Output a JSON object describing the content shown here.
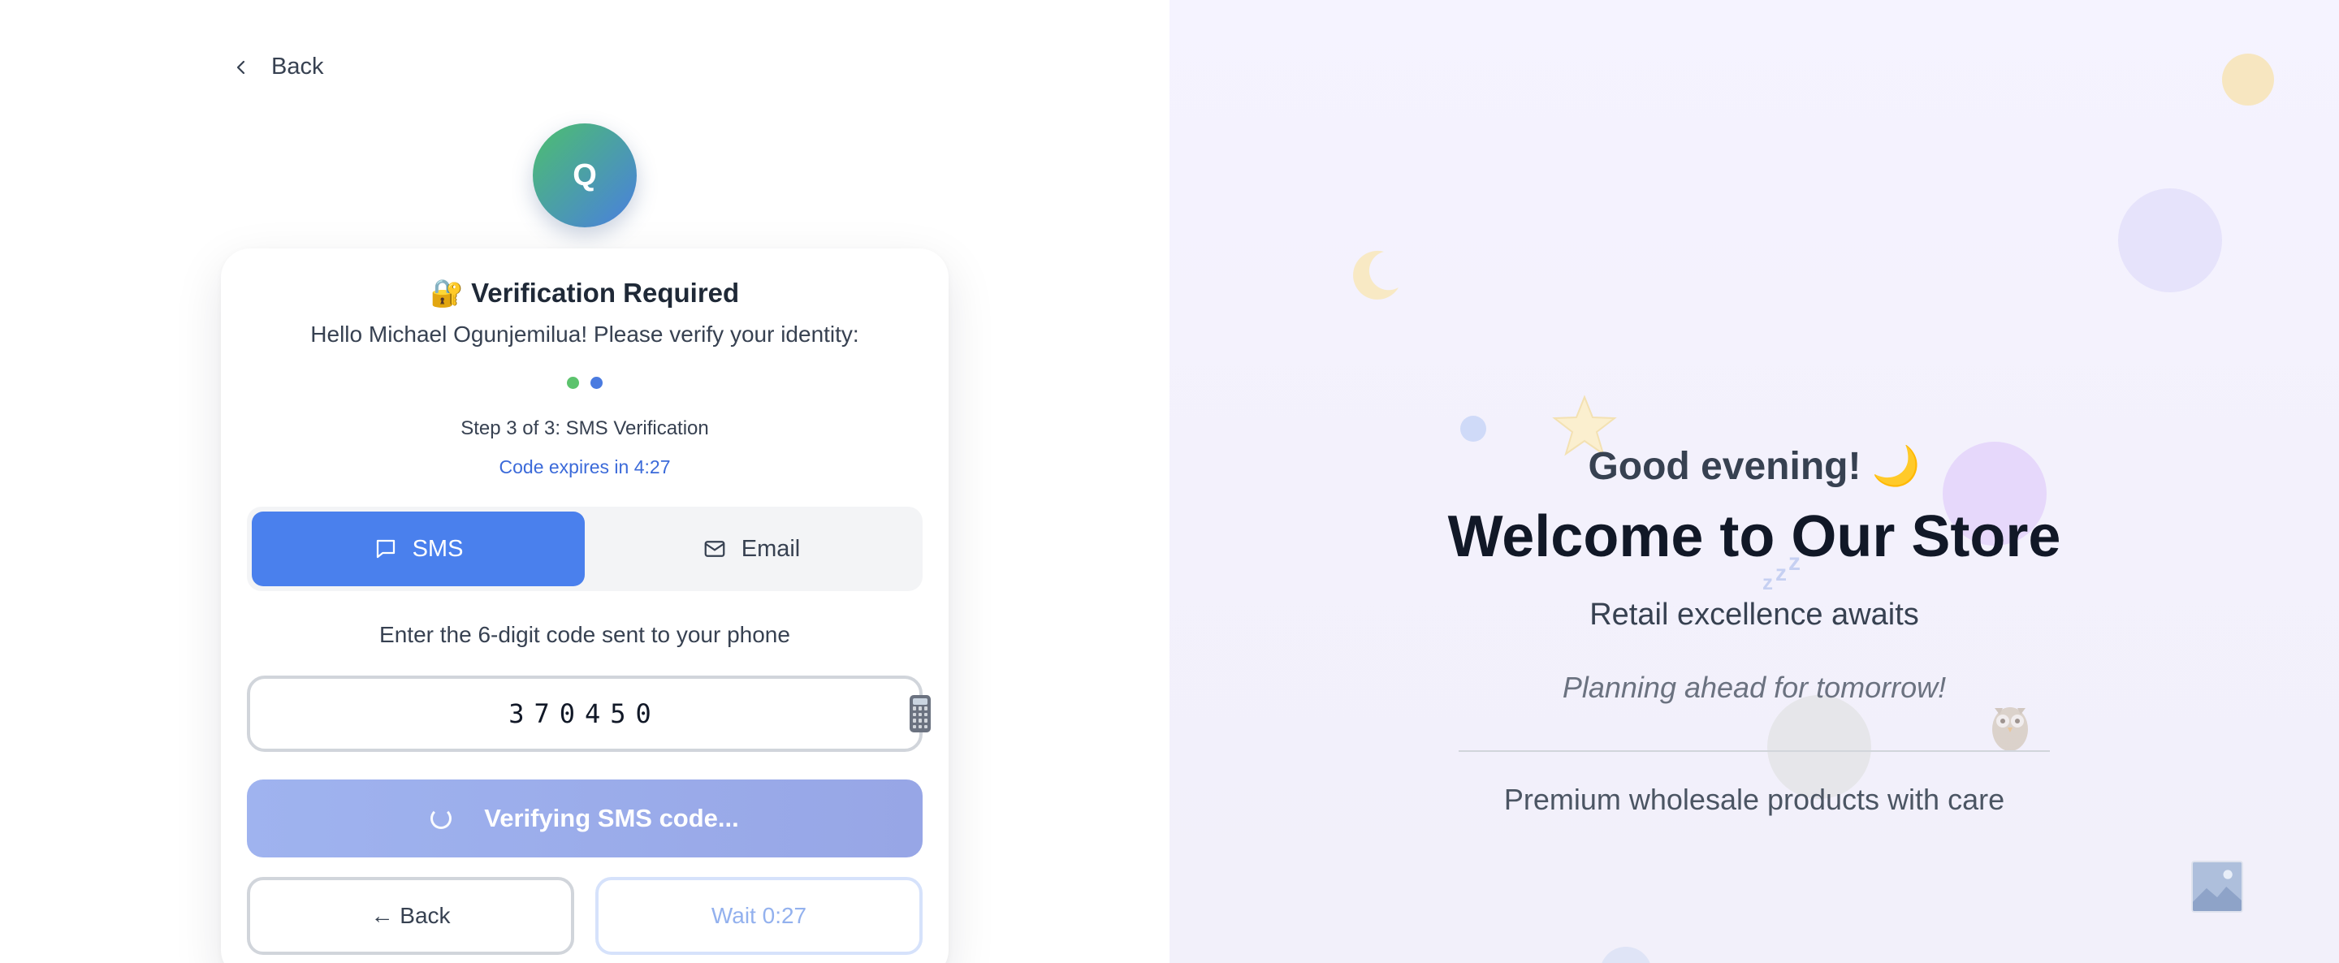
{
  "verification": {
    "back_label": "Back",
    "avatar_initial": "Q",
    "title": "🔐 Verification Required",
    "greeting": "Hello Michael Ogunjemilua! Please verify your identity:",
    "progress_dots": [
      {
        "state": "complete",
        "color": "#5cc36d"
      },
      {
        "state": "current",
        "color": "#4a7be0"
      }
    ],
    "step_text": "Step 3 of 3: SMS Verification",
    "expires_text": "Code expires in 4:27",
    "methods": [
      {
        "label": "SMS",
        "icon": "message-icon",
        "active": true
      },
      {
        "label": "Email",
        "icon": "mail-icon",
        "active": false
      }
    ],
    "instruction": "Enter the 6-digit code sent to your phone",
    "code_value": "370450",
    "code_suffix_icon": "phone-icon",
    "verify_button_label": "Verifying SMS code...",
    "back_button_label": "← Back",
    "wait_button_label": "Wait 0:27"
  },
  "hero": {
    "greeting": "Good evening! 🌙",
    "title": "Welcome to Our Store",
    "tagline": "Retail excellence awaits",
    "subtagline": "Planning ahead for tomorrow!",
    "description": "Premium wholesale products with care",
    "decorations": [
      "moon-icon",
      "star-icon",
      "zzz-icon",
      "owl-icon",
      "picture-icon"
    ]
  },
  "colors": {
    "primary": "#4a80ed",
    "link": "#3b6ad9",
    "verify_button": "#9fb3ef",
    "hero_background": "#f4f2fd"
  }
}
